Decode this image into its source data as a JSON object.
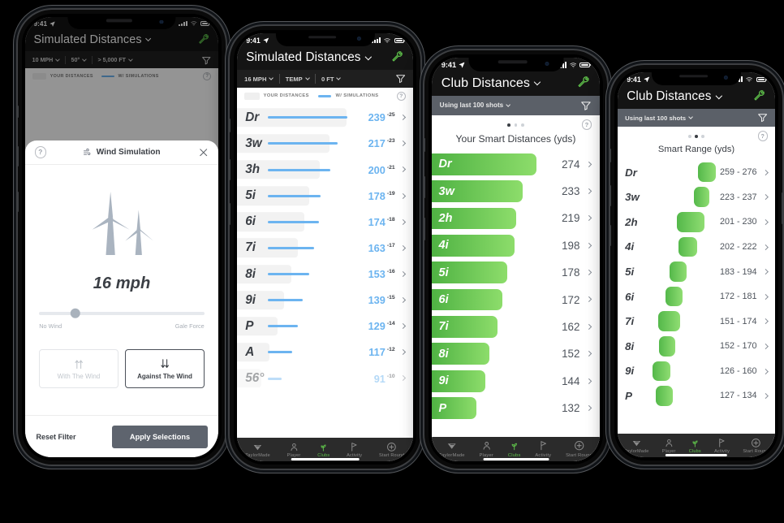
{
  "colors": {
    "green_accent": "#5ec04a",
    "blue_line": "#6cb4f0",
    "bar_green_dark": "#4fb243",
    "bar_green_light": "#8ddd6b",
    "header_dark": "#141414",
    "filter_grey": "#5b6068",
    "apply_button": "#5e646e"
  },
  "status_bar": {
    "time": "9:41",
    "location_icon": "location-arrow-icon",
    "signal_icon": "cellular-signal-icon",
    "wifi_icon": "wifi-icon",
    "battery_icon": "battery-icon"
  },
  "tab_bar": {
    "items": [
      {
        "label": "TaylorMade",
        "icon": "taylormade-logo-icon",
        "active": false
      },
      {
        "label": "Player",
        "icon": "person-icon",
        "active": false
      },
      {
        "label": "Clubs",
        "icon": "sprout-icon",
        "active": true
      },
      {
        "label": "Activity",
        "icon": "flag-icon",
        "active": false
      },
      {
        "label": "Start Round",
        "icon": "plus-circle-icon",
        "active": false
      }
    ]
  },
  "phone1": {
    "header": {
      "title": "Simulated Distances",
      "chevron": "chevron-down-icon",
      "action_icon": "wrench-icon"
    },
    "filters": [
      {
        "label": "10 MPH",
        "chevron": "chevron-down-icon"
      },
      {
        "label": "50°",
        "chevron": "chevron-down-icon"
      },
      {
        "label": "> 5,000 FT",
        "chevron": "chevron-down-icon"
      }
    ],
    "filter_icon": "funnel-icon",
    "legend": {
      "your_distances": "YOUR DISTANCES",
      "with_simulations": "W/ SIMULATIONS",
      "help": "?"
    },
    "modal": {
      "help": "?",
      "title": "Wind Simulation",
      "title_icon": "wind-icon",
      "close_icon": "close-icon",
      "graphic_icon": "wind-turbines-icon",
      "value": "16 mph",
      "slider_percent": 22,
      "slider_min_label": "No Wind",
      "slider_max_label": "Gale Force",
      "options": [
        {
          "label": "With The Wind",
          "icon": "arrows-up-icon",
          "selected": false
        },
        {
          "label": "Against The Wind",
          "icon": "arrows-down-icon",
          "selected": true
        }
      ],
      "reset_label": "Reset Filter",
      "apply_label": "Apply Selections"
    }
  },
  "phone2": {
    "header": {
      "title": "Simulated Distances",
      "chevron": "chevron-down-icon",
      "action_icon": "wrench-icon"
    },
    "filters": [
      {
        "label": "16 MPH",
        "chevron": "chevron-down-icon"
      },
      {
        "label": "TEMP",
        "chevron": "chevron-down-icon"
      },
      {
        "label": "0 FT",
        "chevron": "chevron-down-icon"
      }
    ],
    "filter_icon": "funnel-icon",
    "legend": {
      "your_distances": "YOUR DISTANCES",
      "with_simulations": "W/ SIMULATIONS",
      "help": "?"
    },
    "chart_data": {
      "type": "bar",
      "title": "Simulated Distances",
      "xlabel": "",
      "ylabel": "",
      "categories": [
        "Dr",
        "3w",
        "3h",
        "5i",
        "6i",
        "7i",
        "8i",
        "9i",
        "P",
        "A",
        "56°"
      ],
      "values": [
        239,
        217,
        200,
        178,
        174,
        163,
        153,
        139,
        129,
        117,
        91
      ],
      "deltas": [
        "-25",
        "-23",
        "-21",
        "-19",
        "-18",
        "-17",
        "-16",
        "-15",
        "-14",
        "-12",
        "-10"
      ],
      "units": "yds"
    },
    "rows": [
      {
        "club": "Dr",
        "value": "239",
        "delta": "-25",
        "bar_pct": 100,
        "track_pct": 100,
        "chevron": "chevron-right-icon"
      },
      {
        "club": "3w",
        "value": "217",
        "delta": "-23",
        "bar_pct": 88,
        "track_pct": 85,
        "chevron": "chevron-right-icon"
      },
      {
        "club": "3h",
        "value": "200",
        "delta": "-21",
        "bar_pct": 79,
        "track_pct": 76,
        "chevron": "chevron-right-icon"
      },
      {
        "club": "5i",
        "value": "178",
        "delta": "-19",
        "bar_pct": 66,
        "track_pct": 66,
        "chevron": "chevron-right-icon"
      },
      {
        "club": "6i",
        "value": "174",
        "delta": "-18",
        "bar_pct": 64,
        "track_pct": 62,
        "chevron": "chevron-right-icon"
      },
      {
        "club": "7i",
        "value": "163",
        "delta": "-17",
        "bar_pct": 58,
        "track_pct": 56,
        "chevron": "chevron-right-icon"
      },
      {
        "club": "8i",
        "value": "153",
        "delta": "-16",
        "bar_pct": 52,
        "track_pct": 50,
        "chevron": "chevron-right-icon"
      },
      {
        "club": "9i",
        "value": "139",
        "delta": "-15",
        "bar_pct": 44,
        "track_pct": 43,
        "chevron": "chevron-right-icon"
      },
      {
        "club": "P",
        "value": "129",
        "delta": "-14",
        "bar_pct": 38,
        "track_pct": 37,
        "chevron": "chevron-right-icon"
      },
      {
        "club": "A",
        "value": "117",
        "delta": "-12",
        "bar_pct": 31,
        "track_pct": 30,
        "chevron": "chevron-right-icon"
      },
      {
        "club": "56°",
        "value": "91",
        "delta": "-10",
        "bar_pct": 18,
        "track_pct": 22,
        "chevron": "chevron-right-icon"
      }
    ]
  },
  "phone3": {
    "header": {
      "title": "Club Distances",
      "chevron": "chevron-down-icon",
      "action_icon": "wrench-icon"
    },
    "filter": {
      "label": "Using last 100 shots",
      "chevron": "chevron-down-icon",
      "filter_icon": "funnel-icon"
    },
    "pager": {
      "count": 3,
      "active": 0
    },
    "section_title": "Your Smart Distances (yds)",
    "help": "?",
    "chart_data": {
      "type": "bar",
      "title": "Your Smart Distances (yds)",
      "xlabel": "",
      "ylabel": "",
      "categories": [
        "Dr",
        "3w",
        "2h",
        "4i",
        "5i",
        "6i",
        "7i",
        "8i",
        "9i",
        "P"
      ],
      "values": [
        274,
        233,
        219,
        198,
        178,
        172,
        162,
        152,
        144,
        132
      ],
      "units": "yds"
    },
    "rows": [
      {
        "club": "Dr",
        "value": "274",
        "bar_pct": 100,
        "chevron": "chevron-right-icon"
      },
      {
        "club": "3w",
        "value": "233",
        "bar_pct": 87,
        "chevron": "chevron-right-icon"
      },
      {
        "club": "2h",
        "value": "219",
        "bar_pct": 81,
        "chevron": "chevron-right-icon"
      },
      {
        "club": "4i",
        "value": "198",
        "bar_pct": 79,
        "chevron": "chevron-right-icon"
      },
      {
        "club": "5i",
        "value": "178",
        "bar_pct": 72,
        "chevron": "chevron-right-icon"
      },
      {
        "club": "6i",
        "value": "172",
        "bar_pct": 68,
        "chevron": "chevron-right-icon"
      },
      {
        "club": "7i",
        "value": "162",
        "bar_pct": 63,
        "chevron": "chevron-right-icon"
      },
      {
        "club": "8i",
        "value": "152",
        "bar_pct": 55,
        "chevron": "chevron-right-icon"
      },
      {
        "club": "9i",
        "value": "144",
        "bar_pct": 51,
        "chevron": "chevron-right-icon"
      },
      {
        "club": "P",
        "value": "132",
        "bar_pct": 43,
        "chevron": "chevron-right-icon"
      }
    ]
  },
  "phone4": {
    "header": {
      "title": "Club Distances",
      "chevron": "chevron-down-icon",
      "action_icon": "wrench-icon"
    },
    "filter": {
      "label": "Using last 100 shots",
      "chevron": "chevron-down-icon",
      "filter_icon": "funnel-icon"
    },
    "pager": {
      "count": 3,
      "active": 1
    },
    "section_title": "Smart Range (yds)",
    "help": "?",
    "chart_data": {
      "type": "bar",
      "title": "Smart Range (yds)",
      "subtitle": "floating range bars (min – max carry)",
      "xlabel": "",
      "ylabel": "",
      "categories": [
        "Dr",
        "3w",
        "2h",
        "4i",
        "5i",
        "6i",
        "7i",
        "8i",
        "9i",
        "P"
      ],
      "ranges": [
        [
          259,
          276
        ],
        [
          223,
          237
        ],
        [
          201,
          230
        ],
        [
          202,
          222
        ],
        [
          183,
          194
        ],
        [
          172,
          181
        ],
        [
          151,
          174
        ],
        [
          152,
          170
        ],
        [
          126,
          160
        ],
        [
          127,
          134
        ]
      ],
      "units": "yds"
    },
    "rows": [
      {
        "club": "Dr",
        "range": "259 - 276",
        "left_pct": 62,
        "width_pct": 18,
        "chevron": "chevron-right-icon"
      },
      {
        "club": "3w",
        "range": "223 - 237",
        "left_pct": 58,
        "width_pct": 16,
        "chevron": "chevron-right-icon"
      },
      {
        "club": "2h",
        "range": "201 - 230",
        "left_pct": 40,
        "width_pct": 29,
        "chevron": "chevron-right-icon"
      },
      {
        "club": "4i",
        "range": "202 - 222",
        "left_pct": 42,
        "width_pct": 19,
        "chevron": "chevron-right-icon"
      },
      {
        "club": "5i",
        "range": "183 - 194",
        "left_pct": 33,
        "width_pct": 17,
        "chevron": "chevron-right-icon"
      },
      {
        "club": "6i",
        "range": "172 - 181",
        "left_pct": 29,
        "width_pct": 17,
        "chevron": "chevron-right-icon"
      },
      {
        "club": "7i",
        "range": "151 - 174",
        "left_pct": 21,
        "width_pct": 23,
        "chevron": "chevron-right-icon"
      },
      {
        "club": "8i",
        "range": "152 - 170",
        "left_pct": 22,
        "width_pct": 17,
        "chevron": "chevron-right-icon"
      },
      {
        "club": "9i",
        "range": "126 - 160",
        "left_pct": 15,
        "width_pct": 19,
        "chevron": "chevron-right-icon"
      },
      {
        "club": "P",
        "range": "127 - 134",
        "left_pct": 19,
        "width_pct": 17,
        "chevron": "chevron-right-icon"
      }
    ]
  }
}
